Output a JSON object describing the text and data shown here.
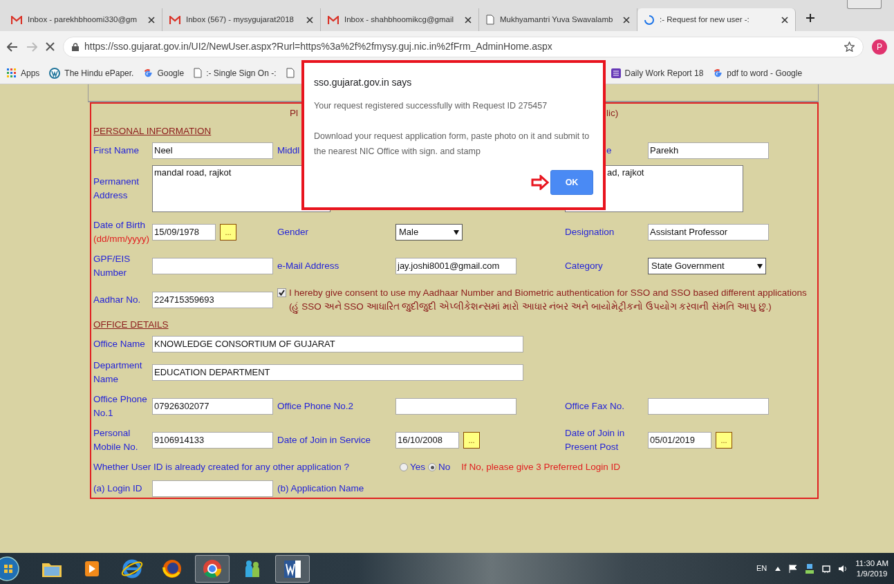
{
  "browser": {
    "tabs": [
      {
        "title": "Inbox - parekhbhoomi330@gm",
        "kind": "mail",
        "selected": false
      },
      {
        "title": "Inbox (567) - mysygujarat2018",
        "kind": "mail",
        "selected": false
      },
      {
        "title": "Inbox - shahbhoomikcg@gmail",
        "kind": "mail",
        "selected": false
      },
      {
        "title": "Mukhyamantri Yuva Swavalamb",
        "kind": "page",
        "selected": false
      },
      {
        "title": ":- Request for new user -:",
        "kind": "loading",
        "selected": true
      }
    ],
    "url": "https://sso.gujarat.gov.in/UI2/NewUser.aspx?Rurl=https%3a%2f%2fmysy.guj.nic.in%2fFrm_AdminHome.aspx",
    "profile_initial": "P",
    "bookmarks": [
      {
        "label": "Apps",
        "kind": "apps"
      },
      {
        "label": "The Hindu ePaper.",
        "kind": "site"
      },
      {
        "label": "Google",
        "kind": "google"
      },
      {
        "label": ":- Single Sign On -:",
        "kind": "page"
      },
      {
        "kind": "page"
      },
      {
        "label": "Daily Work Report 18",
        "kind": "list"
      },
      {
        "label": "pdf to word - Google",
        "kind": "google"
      }
    ]
  },
  "form": {
    "header": [
      {
        "text": "Pl",
        "kind": "start"
      },
      {
        "text": "lic)",
        "kind": "fragment"
      }
    ],
    "sections": [
      {
        "heading": "PERSONAL INFORMATION",
        "rows": [
          {
            "label_1": {
              "text": "First Name"
            },
            "field_1": {
              "kind": "text",
              "value": "Neel"
            },
            "label_2": {
              "text": "Middl"
            },
            "label_3": {
              "text": "e",
              "kind": "fragment"
            },
            "field_3": {
              "kind": "text",
              "value": "Parekh"
            }
          },
          {
            "label_1": {
              "text": "Permanent Address"
            },
            "field_1": {
              "kind": "textarea",
              "value": "mandal road, rajkot"
            },
            "field_3": {
              "kind": "textarea",
              "value": "ad, rajkot",
              "fragment": true
            }
          },
          {
            "label_1": {
              "text": "Date of Birth",
              "hint": "(dd/mm/yyyy)"
            },
            "field_1": {
              "kind": "date",
              "value": "15/09/1978",
              "button": "..."
            },
            "label_2": {
              "text": "Gender"
            },
            "field_2": {
              "kind": "select",
              "value": "Male"
            },
            "label_3": {
              "text": "Designation"
            },
            "field_3": {
              "kind": "text",
              "value": "Assistant Professor"
            }
          },
          {
            "label_1": {
              "text": "GPF/EIS Number"
            },
            "field_1": {
              "kind": "text"
            },
            "label_2": {
              "text": "e-Mail Address"
            },
            "field_2": {
              "kind": "text",
              "value": "jay.joshi8001@gmail.com"
            },
            "label_3": {
              "text": "Category"
            },
            "field_3": {
              "kind": "select",
              "value": "State Government"
            }
          },
          {
            "label_1": {
              "text": "Aadhar No."
            },
            "field_1": {
              "kind": "text",
              "value": "224715359693"
            },
            "consent": {
              "checked": true,
              "text": "I hereby give consent to use my Aadhaar Number and Biometric authentication for SSO and SSO based different applications (હું SSO અને SSO આધારિત જુદીજુદી એપ્લીકેશન્સમાં મારો આધાર નંબર અને બાયોમેટ્રીકનો ઉપયોગ કરવાની સંમતિ આપુ છુ.)"
            }
          }
        ]
      },
      {
        "heading": "OFFICE DETAILS",
        "rows": [
          {
            "label_1": {
              "text": "Office Name"
            },
            "field_1": {
              "kind": "text",
              "value": "KNOWLEDGE CONSORTIUM OF GUJARAT"
            }
          },
          {
            "label_1": {
              "text": "Department Name"
            },
            "field_1": {
              "kind": "text",
              "value": "EDUCATION DEPARTMENT"
            }
          },
          {
            "label_1": {
              "text": "Office Phone No.1"
            },
            "field_1": {
              "kind": "text",
              "value": "07926302077"
            },
            "label_2": {
              "text": "Office Phone No.2"
            },
            "field_2": {
              "kind": "text"
            },
            "label_3": {
              "text": "Office Fax No."
            },
            "field_3": {
              "kind": "text"
            }
          },
          {
            "label_1": {
              "text": "Personal Mobile No."
            },
            "field_1": {
              "kind": "text",
              "value": "9106914133"
            },
            "label_2": {
              "text": "Date of Join in Service"
            },
            "field_2": {
              "kind": "date",
              "value": "16/10/2008",
              "button": "..."
            },
            "label_3": {
              "text": "Date of Join in Present Post"
            },
            "field_3": {
              "kind": "date",
              "value": "05/01/2019",
              "button": "..."
            }
          },
          {
            "question": "Whether User ID is already created for any other application ?",
            "options": [
              {
                "label": "Yes",
                "selected": false
              },
              {
                "label": "No",
                "selected": true
              }
            ],
            "note": "If No, please give 3 Preferred Login ID"
          },
          {
            "label_1": {
              "text": "(a) Login ID"
            },
            "field_1": {
              "kind": "text"
            },
            "label_2": {
              "text": "(b) Application Name"
            }
          }
        ]
      }
    ]
  },
  "dialog": {
    "title": "sso.gujarat.gov.in says",
    "lines": [
      "Your request registered successfully with Request ID 275457",
      "Download your request application form, paste photo on it and submit to the nearest NIC Office with sign. and stamp"
    ],
    "button": "OK"
  },
  "taskbar": {
    "apps": [
      {
        "kind": "folder",
        "active": false
      },
      {
        "kind": "media",
        "active": false
      },
      {
        "kind": "ie",
        "active": false
      },
      {
        "kind": "firefox",
        "active": false
      },
      {
        "kind": "chrome",
        "active": true
      },
      {
        "kind": "messenger",
        "active": false
      },
      {
        "kind": "word",
        "active": true
      }
    ],
    "language": "EN",
    "time": "11:30 AM",
    "date": "1/9/2019"
  }
}
